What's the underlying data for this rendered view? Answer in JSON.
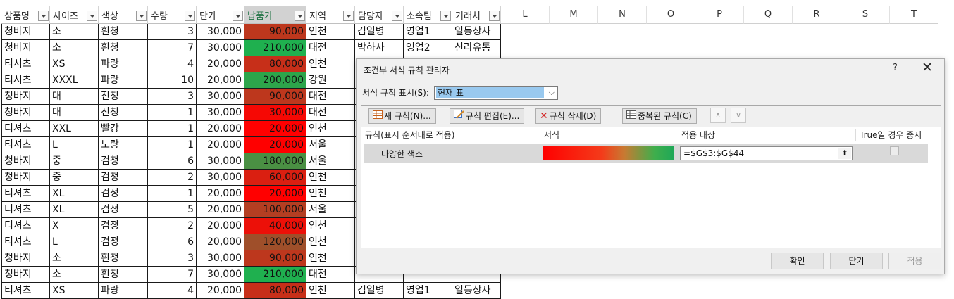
{
  "sheet": {
    "headers": [
      {
        "label": "상품명"
      },
      {
        "label": "사이즈"
      },
      {
        "label": "색상"
      },
      {
        "label": "수량"
      },
      {
        "label": "단가"
      },
      {
        "label": "납품가"
      },
      {
        "label": "지역"
      },
      {
        "label": "담당자"
      },
      {
        "label": "소속팀"
      },
      {
        "label": "거래처"
      }
    ],
    "col_letters": [
      "L",
      "M",
      "N",
      "O",
      "P",
      "Q",
      "R",
      "S",
      "T"
    ],
    "rows": [
      [
        "청바지",
        "소",
        "흰청",
        "3",
        "30,000",
        "90,000",
        "인천",
        "김일병",
        "영업1",
        "일등상사"
      ],
      [
        "청바지",
        "소",
        "흰청",
        "7",
        "30,000",
        "210,000",
        "대전",
        "박하사",
        "영업2",
        "신라유통"
      ],
      [
        "티셔츠",
        "XS",
        "파랑",
        "4",
        "20,000",
        "80,000",
        "인천",
        "",
        "",
        ""
      ],
      [
        "티셔츠",
        "XXXL",
        "파랑",
        "10",
        "20,000",
        "200,000",
        "강원",
        "",
        "",
        ""
      ],
      [
        "청바지",
        "대",
        "진청",
        "3",
        "30,000",
        "90,000",
        "대전",
        "",
        "",
        ""
      ],
      [
        "청바지",
        "대",
        "진청",
        "1",
        "30,000",
        "30,000",
        "대전",
        "",
        "",
        ""
      ],
      [
        "티셔츠",
        "XXL",
        "빨강",
        "1",
        "20,000",
        "20,000",
        "인천",
        "",
        "",
        ""
      ],
      [
        "티셔츠",
        "L",
        "노랑",
        "1",
        "20,000",
        "20,000",
        "서울",
        "",
        "",
        ""
      ],
      [
        "청바지",
        "중",
        "검청",
        "6",
        "30,000",
        "180,000",
        "서울",
        "",
        "",
        ""
      ],
      [
        "청바지",
        "중",
        "검청",
        "2",
        "30,000",
        "60,000",
        "인천",
        "",
        "",
        ""
      ],
      [
        "티셔츠",
        "XL",
        "검정",
        "1",
        "20,000",
        "20,000",
        "인천",
        "",
        "",
        ""
      ],
      [
        "티셔츠",
        "XL",
        "검정",
        "5",
        "20,000",
        "100,000",
        "서울",
        "",
        "",
        ""
      ],
      [
        "티셔츠",
        "X",
        "검정",
        "2",
        "20,000",
        "40,000",
        "인천",
        "",
        "",
        ""
      ],
      [
        "티셔츠",
        "L",
        "검정",
        "6",
        "20,000",
        "120,000",
        "인천",
        "",
        "",
        ""
      ],
      [
        "청바지",
        "소",
        "흰청",
        "3",
        "30,000",
        "90,000",
        "인천",
        "",
        "",
        ""
      ],
      [
        "청바지",
        "소",
        "흰청",
        "7",
        "30,000",
        "210,000",
        "대전",
        "",
        "",
        ""
      ],
      [
        "티셔츠",
        "XS",
        "파랑",
        "4",
        "20,000",
        "80,000",
        "인천",
        "김일병",
        "영업1",
        "일등상사"
      ]
    ],
    "color_scale": {
      "min": "#ff0000",
      "mid": "#a64a28",
      "max": "#1fb04f"
    }
  },
  "dialog": {
    "title": "조건부 서식 규칙 관리자",
    "help": "?",
    "close": "✕",
    "show_rules_label": "서식 규칙 표시(S):",
    "show_rules_value": "현재 표",
    "toolbar": {
      "new_rule": "새 규칙(N)...",
      "edit_rule": "규칙 편집(E)...",
      "delete_rule": "규칙 삭제(D)",
      "duplicate_rule": "중복된 규칙(C)",
      "move_up": "∧",
      "move_down": "∨"
    },
    "columns": {
      "rule": "규칙(표시 순서대로 적용)",
      "format": "서식",
      "applies_to": "적용 대상",
      "stop_if_true": "True일 경우 중지"
    },
    "rule": {
      "name": "다양한 색조",
      "applies_to": "=$G$3:$G$44"
    },
    "buttons": {
      "ok": "확인",
      "close": "닫기",
      "apply": "적용"
    }
  }
}
